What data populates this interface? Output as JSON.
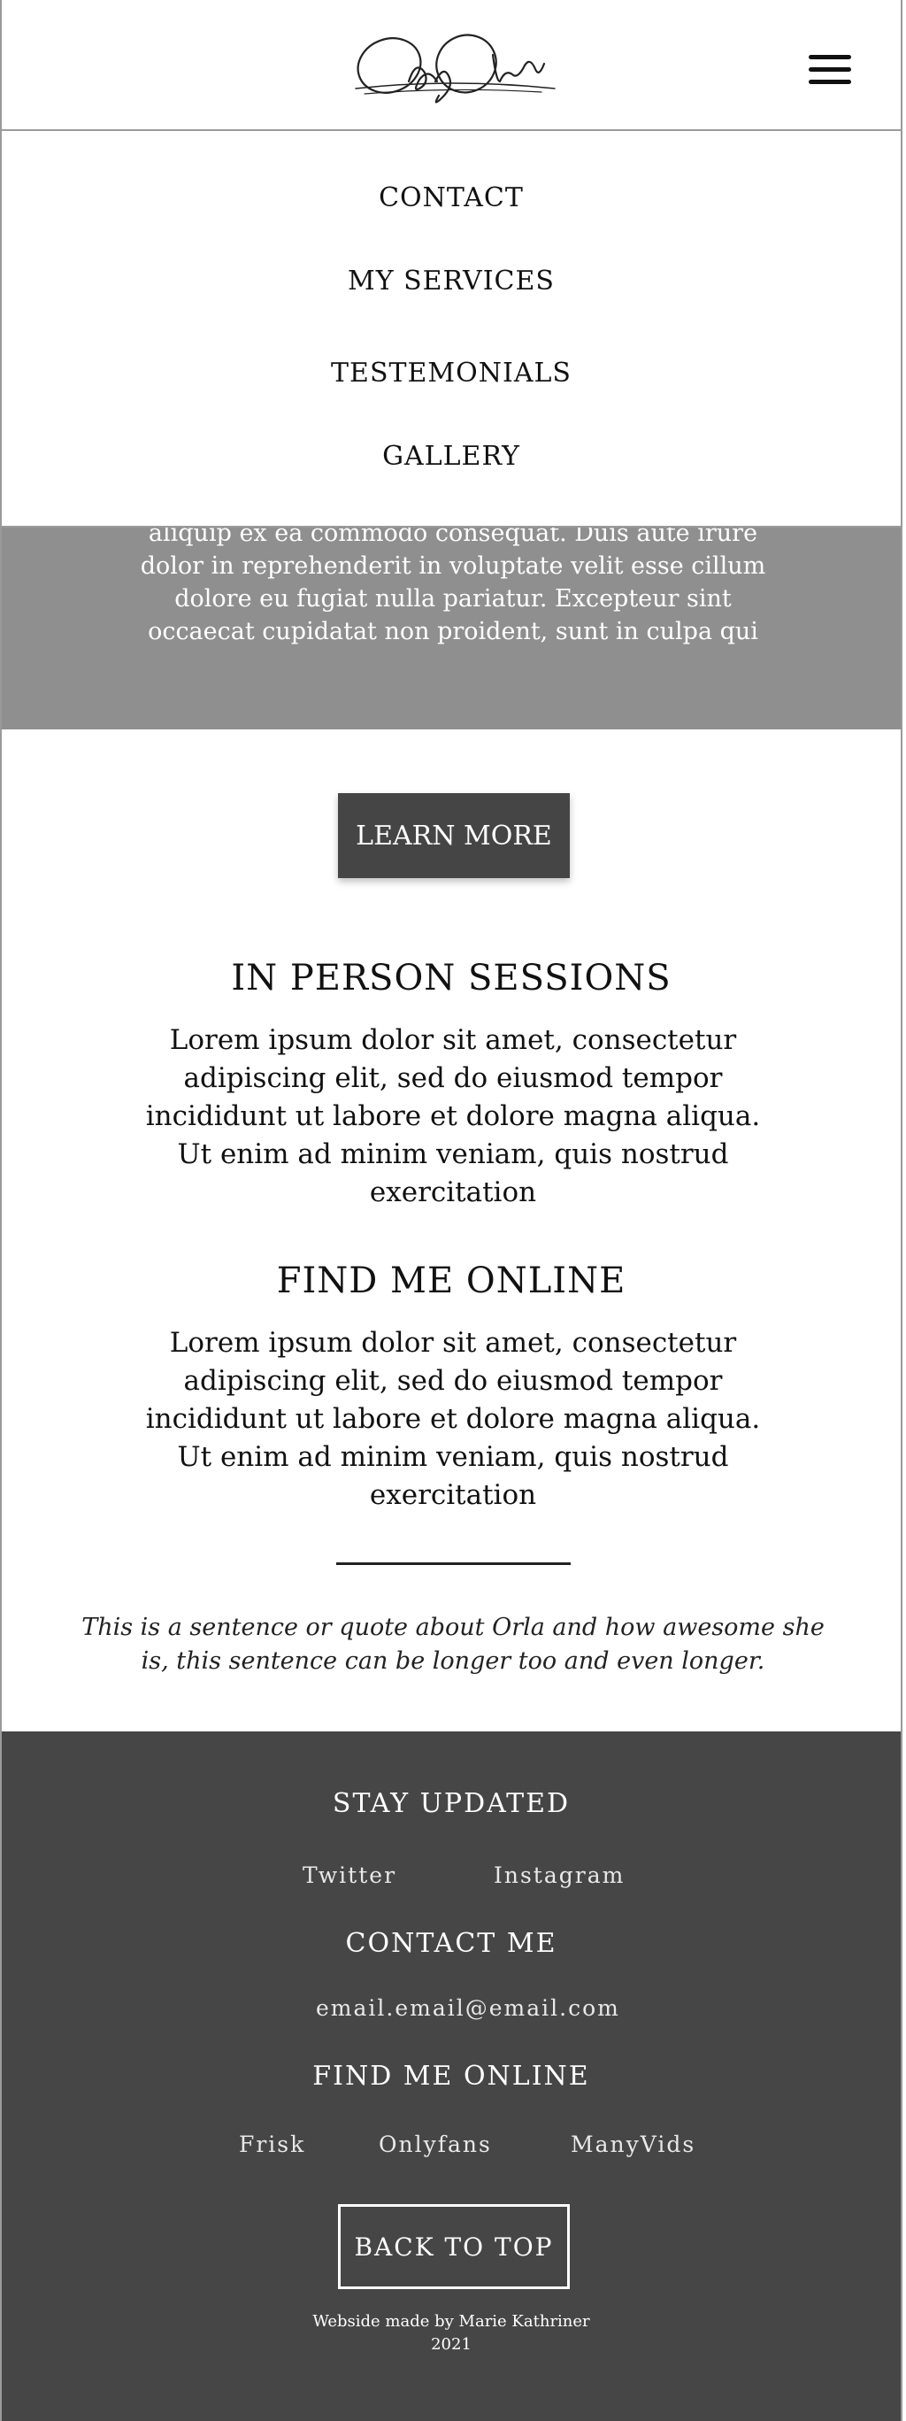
{
  "header": {
    "logo_text": "ObeyOrla",
    "menu_icon": "hamburger-menu-icon"
  },
  "nav": {
    "items": [
      "CONTACT",
      "MY SERVICES",
      "TESTEMONIALS",
      "GALLERY"
    ]
  },
  "gray_band": {
    "text": "aliquip ex ea commodo consequat. Duis aute irure dolor in reprehenderit in voluptate velit esse cillum dolore eu fugiat nulla pariatur. Excepteur sint occaecat cupidatat non proident, sunt in culpa qui"
  },
  "learn_more": {
    "label": "LEARN MORE"
  },
  "sections": [
    {
      "title": "IN PERSON SESSIONS",
      "text": "Lorem ipsum dolor sit amet, consectetur adipiscing elit, sed do eiusmod tempor incididunt ut labore et dolore magna aliqua. Ut enim ad minim veniam, quis nostrud exercitation"
    },
    {
      "title": "FIND ME ONLINE",
      "text": "Lorem ipsum dolor sit amet, consectetur adipiscing elit, sed do eiusmod tempor incididunt ut labore et dolore magna aliqua. Ut enim ad minim veniam, quis nostrud exercitation"
    }
  ],
  "quote": "This is a sentence or quote about Orla and how awesome she is, this sentence can be longer too and even longer.",
  "footer": {
    "stay_updated": {
      "title": "STAY UPDATED",
      "links": [
        "Twitter",
        "Instagram"
      ]
    },
    "contact": {
      "title": "CONTACT ME",
      "email": "email.email@email.com"
    },
    "find_online": {
      "title": "FIND ME ONLINE",
      "links": [
        "Frisk",
        "Onlyfans",
        "ManyVids"
      ]
    },
    "back_to_top": "BACK TO TOP",
    "credit_line1": "Webside made by Marie Kathriner",
    "credit_line2": "2021"
  },
  "colors": {
    "gray_band": "#8f8f8f",
    "button_dark": "#454545",
    "footer_bg": "#464646"
  }
}
